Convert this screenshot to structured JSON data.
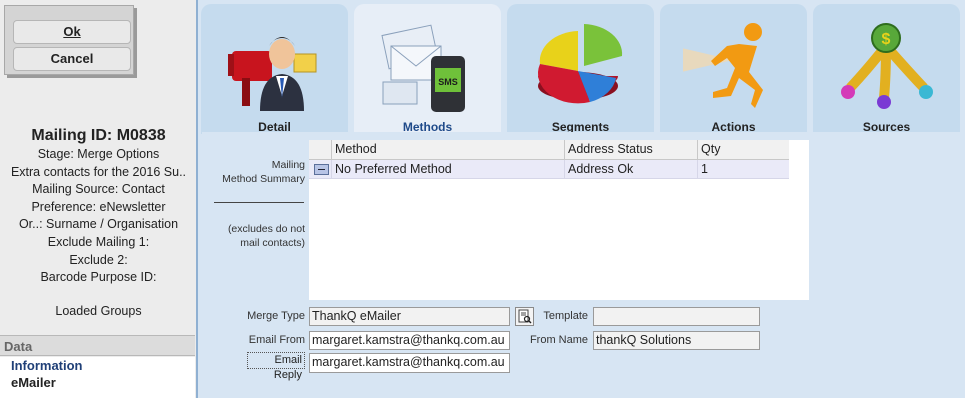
{
  "buttons": {
    "ok": "Ok",
    "cancel": "Cancel"
  },
  "mailing": {
    "id_line": "Mailing ID: M0838",
    "lines": [
      "Stage: Merge Options",
      "Extra contacts for the 2016 Su..",
      "Mailing Source: Contact",
      "Preference: eNewsletter",
      "Or..: Surname / Organisation",
      "Exclude Mailing 1:",
      "Exclude 2:",
      "Barcode Purpose ID:"
    ],
    "loaded_groups": "Loaded Groups"
  },
  "data_panel": {
    "header": "Data",
    "items": [
      "Information",
      "eMailer"
    ]
  },
  "tabs": [
    {
      "label": "Detail",
      "icon": "mailbox-person-icon"
    },
    {
      "label": "Methods",
      "icon": "sms-mail-icon",
      "active": true
    },
    {
      "label": "Segments",
      "icon": "pie-chart-icon"
    },
    {
      "label": "Actions",
      "icon": "running-figure-icon"
    },
    {
      "label": "Sources",
      "icon": "money-sources-icon"
    }
  ],
  "summary": {
    "label_line1": "Mailing",
    "label_line2": "Method Summary",
    "note_line1": "(excludes do not",
    "note_line2": "mail contacts)",
    "columns": [
      "Method",
      "Address Status",
      "Qty"
    ],
    "rows": [
      {
        "method": "No Preferred Method",
        "address_status": "Address Ok",
        "qty": "1"
      }
    ]
  },
  "form": {
    "merge_type_label": "Merge Type",
    "merge_type_value": "ThankQ eMailer",
    "template_label": "Template",
    "template_value": "",
    "email_from_label": "Email From",
    "email_from_value": "margaret.kamstra@thankq.com.au",
    "from_name_label": "From Name",
    "from_name_value": "thankQ Solutions",
    "email_reply_label": "Email Reply",
    "email_reply_value": "margaret.kamstra@thankq.com.au"
  },
  "colors": {
    "tab_bg": "#c5dbee",
    "tab_active_bg": "#e7eef7",
    "content_bg": "#d7e5f3",
    "selected_row": "#eaeaf8",
    "link_blue": "#1f3f77"
  }
}
